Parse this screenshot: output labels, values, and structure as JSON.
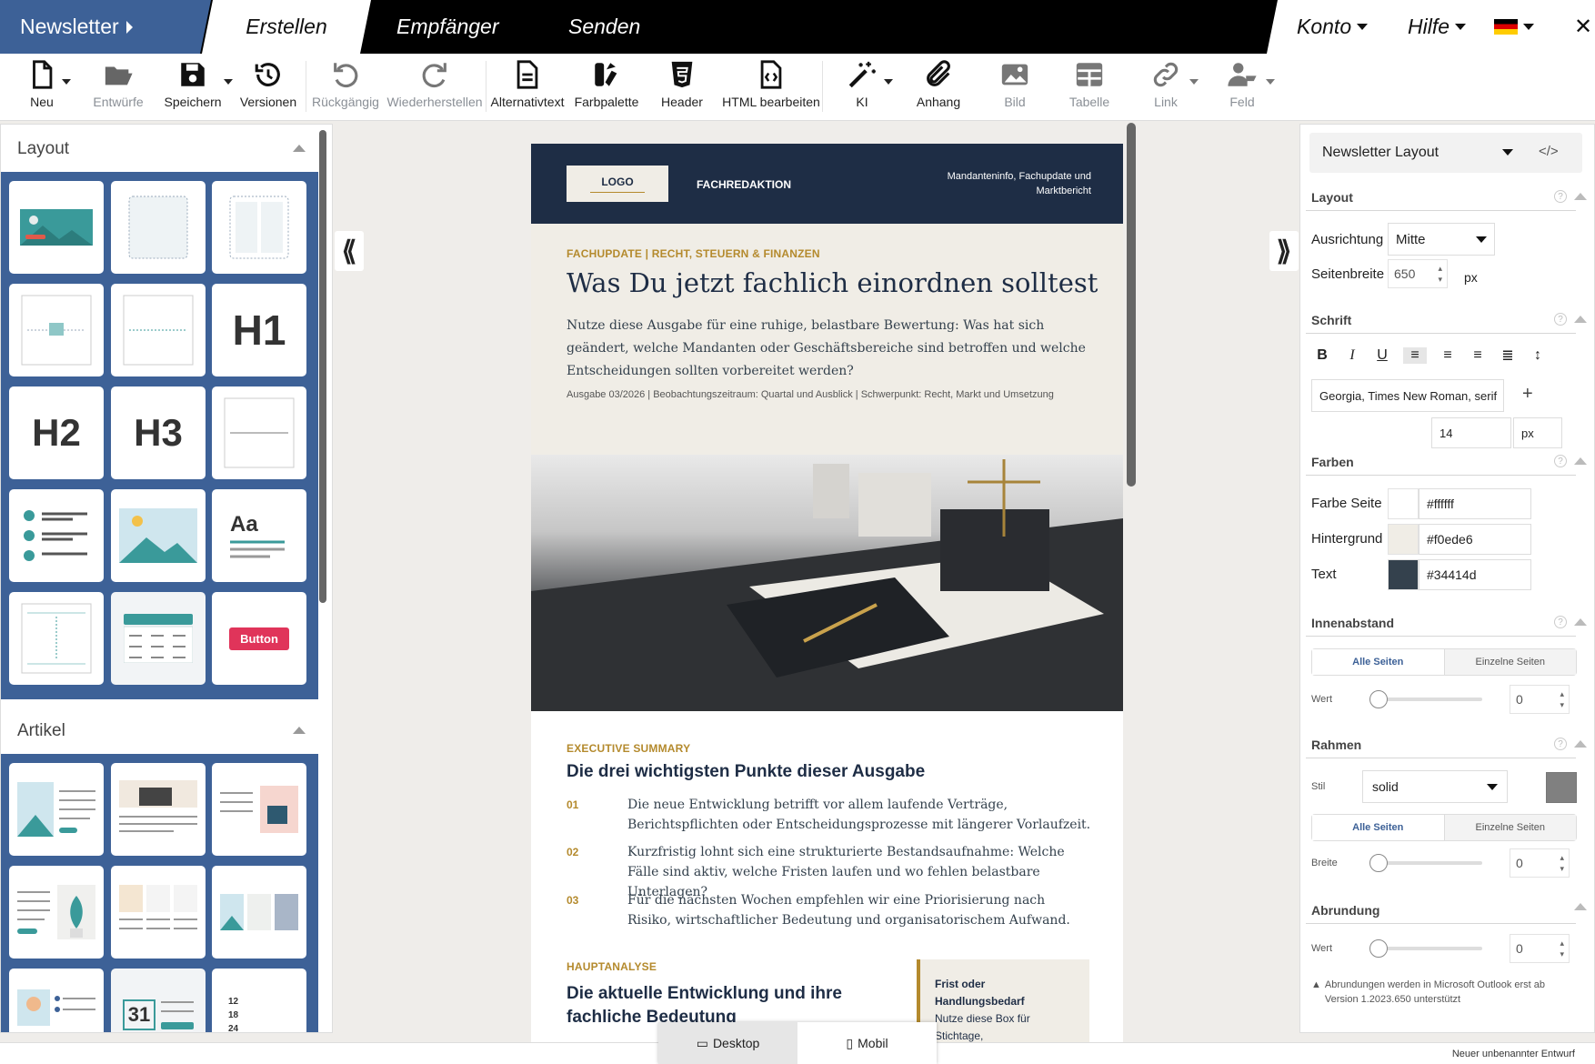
{
  "nav": {
    "newsletter": "Newsletter",
    "erstellen": "Erstellen",
    "empfaenger": "Empfänger",
    "senden": "Senden",
    "konto": "Konto",
    "hilfe": "Hilfe"
  },
  "toolbar": [
    {
      "label": "Neu",
      "icon": "new-file-icon"
    },
    {
      "label": "Entwürfe",
      "icon": "folder-open-icon"
    },
    {
      "label": "Speichern",
      "icon": "save-icon"
    },
    {
      "label": "Versionen",
      "icon": "history-icon"
    },
    {
      "label": "Rückgängig",
      "icon": "undo-icon"
    },
    {
      "label": "Wiederherstellen",
      "icon": "redo-icon"
    },
    {
      "label": "Alternativtext",
      "icon": "document-icon"
    },
    {
      "label": "Farbpalette",
      "icon": "palette-icon"
    },
    {
      "label": "Header",
      "icon": "html5-icon"
    },
    {
      "label": "HTML bearbeiten",
      "icon": "code-file-icon"
    },
    {
      "label": "KI",
      "icon": "magic-wand-icon"
    },
    {
      "label": "Anhang",
      "icon": "paperclip-icon"
    },
    {
      "label": "Bild",
      "icon": "image-icon"
    },
    {
      "label": "Tabelle",
      "icon": "table-icon"
    },
    {
      "label": "Link",
      "icon": "link-icon"
    },
    {
      "label": "Feld",
      "icon": "user-field-icon"
    }
  ],
  "left": {
    "layout_title": "Layout",
    "artikel_title": "Artikel",
    "tiles": {
      "h1": "H1",
      "h2": "H2",
      "h3": "H3",
      "aa": "Aa",
      "button": "Button",
      "cal": "31",
      "n12": "12",
      "n18": "18",
      "n24": "24"
    }
  },
  "email": {
    "logo": "LOGO",
    "brand": "FACHREDAKTION",
    "tagline": "Mandanteninfo, Fachupdate und Marktbericht",
    "kicker": "FACHUPDATE | RECHT, STEUERN & FINANZEN",
    "headline": "Was Du jetzt fachlich einordnen solltest",
    "lead": "Nutze diese Ausgabe für eine ruhige, belastbare Bewertung: Was hat sich geändert, welche Mandanten oder Geschäftsbereiche sind betroffen und welche Entscheidungen sollten vorbereitet werden?",
    "meta": "Ausgabe 03/2026 | Beobachtungszeitraum: Quartal und Ausblick | Schwerpunkt: Recht, Markt und Umsetzung",
    "exec_kicker": "EXECUTIVE SUMMARY",
    "exec_title": "Die drei wichtigsten Punkte dieser Ausgabe",
    "points": [
      {
        "num": "01",
        "text": "Die neue Entwicklung betrifft vor allem laufende Verträge, Berichtspflichten oder Entscheidungsprozesse mit längerer Vorlaufzeit."
      },
      {
        "num": "02",
        "text": "Kurzfristig lohnt sich eine strukturierte Bestandsaufnahme: Welche Fälle sind aktiv, welche Fristen laufen und wo fehlen belastbare Unterlagen?"
      },
      {
        "num": "03",
        "text": "Für die nächsten Wochen empfehlen wir eine Priorisierung nach Risiko, wirtschaftlicher Bedeutung und organisatorischem Aufwand."
      }
    ],
    "haupt_kicker": "HAUPTANALYSE",
    "haupt_title": "Die aktuelle Entwicklung und ihre fachliche Bedeutung",
    "box_title": "Frist oder Handlungsbedarf",
    "box_text": "Nutze diese Box für Stichtage,"
  },
  "right": {
    "layout_select": "Newsletter Layout",
    "layout": "Layout",
    "ausrichtung": "Ausrichtung",
    "ausrichtung_val": "Mitte",
    "seitenbreite": "Seitenbreite",
    "seitenbreite_val": "650",
    "px": "px",
    "schrift": "Schrift",
    "font": "Georgia, Times New Roman, serif",
    "size": "14",
    "size_unit": "px",
    "farben": "Farben",
    "colors": [
      {
        "label": "Farbe Seite",
        "hex": "#ffffff"
      },
      {
        "label": "Hintergrund",
        "hex": "#f0ede6"
      },
      {
        "label": "Text",
        "hex": "#34414d"
      }
    ],
    "innenabstand": "Innenabstand",
    "alle": "Alle Seiten",
    "einzelne": "Einzelne Seiten",
    "wert": "Wert",
    "zero": "0",
    "rahmen": "Rahmen",
    "stil": "Stil",
    "stil_val": "solid",
    "breite": "Breite",
    "abrundung": "Abrundung",
    "note": "Abrundungen werden in Microsoft Outlook erst ab Version 1.2023.650 unterstützt"
  },
  "bottom": {
    "desktop": "Desktop",
    "mobil": "Mobil",
    "draft": "Neuer unbenannter Entwurf"
  }
}
